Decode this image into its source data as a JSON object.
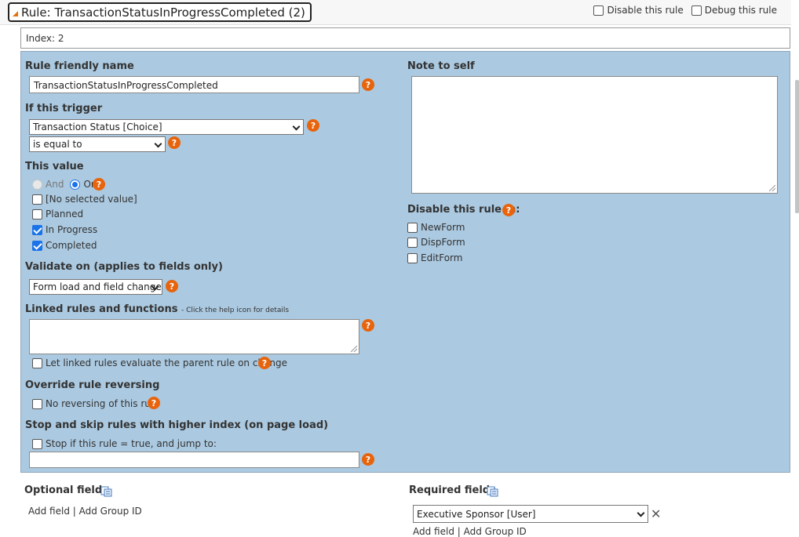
{
  "rule": {
    "title": "Rule: TransactionStatusInProgressCompleted (2)",
    "disable_label": "Disable this rule",
    "debug_label": "Debug this rule",
    "index_text": "Index: 2"
  },
  "friendly_name": {
    "label": "Rule friendly name",
    "value": "TransactionStatusInProgressCompleted"
  },
  "trigger": {
    "label": "If this trigger",
    "field": "Transaction Status [Choice]",
    "operator": "is equal to"
  },
  "this_value": {
    "label": "This value",
    "and_label": "And",
    "or_label": "Or",
    "options": [
      {
        "label": "[No selected value]",
        "checked": false
      },
      {
        "label": "Planned",
        "checked": false
      },
      {
        "label": "In Progress",
        "checked": true
      },
      {
        "label": "Completed",
        "checked": true
      }
    ]
  },
  "validate_on": {
    "label": "Validate on (applies to fields only)",
    "value": "Form load and field change"
  },
  "linked_rules": {
    "label": "Linked rules and functions",
    "hint": "- Click the help icon for details",
    "let_eval_label": "Let linked rules evaluate the parent rule on change"
  },
  "override": {
    "label": "Override rule reversing",
    "no_reverse_label": "No reversing of this rule"
  },
  "stop_skip": {
    "label": "Stop and skip rules with higher index (on page load)",
    "stop_label": "Stop if this rule = true, and jump to:"
  },
  "note": {
    "label": "Note to self"
  },
  "disable_in": {
    "label": "Disable this rule in:",
    "forms": [
      "NewForm",
      "DispForm",
      "EditForm"
    ]
  },
  "optional_fields": {
    "label": "Optional fields",
    "links": "Add field | Add Group ID"
  },
  "required_fields": {
    "label": "Required fields",
    "field_value": "Executive Sponsor [User]",
    "links": "Add field | Add Group ID"
  },
  "help_glyph": "?",
  "colors": {
    "panel": "#abc9e0",
    "help_icon": "#e8640c",
    "check_accent": "#1a73e8"
  }
}
